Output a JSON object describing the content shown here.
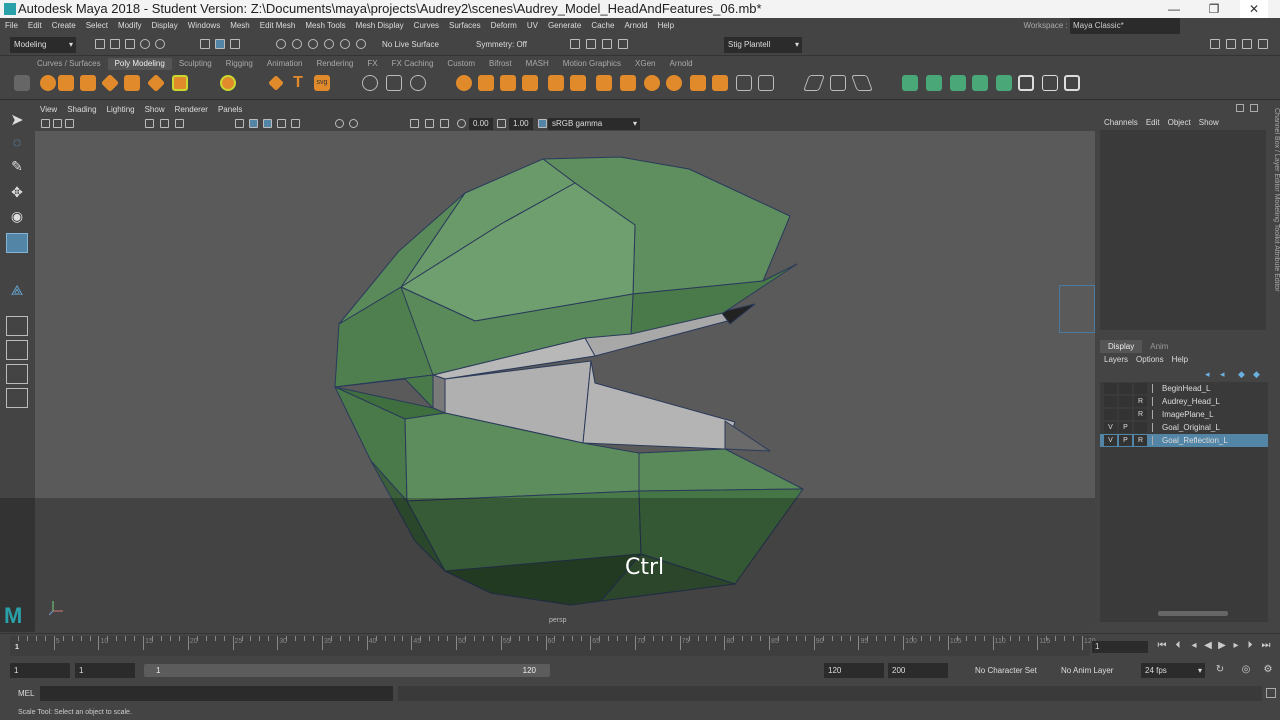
{
  "window": {
    "title": "Autodesk Maya 2018 - Student Version: Z:\\Documents\\maya\\projects\\Audrey2\\scenes\\Audrey_Model_HeadAndFeatures_06.mb*",
    "minimize": "—",
    "maximize": "❐",
    "close": "✕"
  },
  "menubar": {
    "items": [
      "File",
      "Edit",
      "Create",
      "Select",
      "Modify",
      "Display",
      "Windows",
      "Mesh",
      "Edit Mesh",
      "Mesh Tools",
      "Mesh Display",
      "Curves",
      "Surfaces",
      "Deform",
      "UV",
      "Generate",
      "Cache",
      "Arnold",
      "Help"
    ],
    "workspace_label": "Workspace :",
    "workspace_value": "Maya Classic*"
  },
  "statusline": {
    "menuset": "Modeling",
    "live_surface": "No Live Surface",
    "symmetry": "Symmetry: Off",
    "user": "Stig Plantell"
  },
  "shelf": {
    "tabs": [
      "Curves / Surfaces",
      "Poly Modeling",
      "Sculpting",
      "Rigging",
      "Animation",
      "Rendering",
      "FX",
      "FX Caching",
      "Custom",
      "Bifrost",
      "MASH",
      "Motion Graphics",
      "XGen",
      "Arnold"
    ],
    "active_tab": "Poly Modeling",
    "text_icon": "T",
    "svg_icon": "svg"
  },
  "panel": {
    "menus": [
      "View",
      "Shading",
      "Lighting",
      "Show",
      "Renderer",
      "Panels"
    ],
    "exposure": "0.00",
    "gamma": "1.00",
    "colorspace": "sRGB gamma",
    "camera": "persp",
    "key_hint": "Ctrl"
  },
  "channelbox": {
    "menus": [
      "Channels",
      "Edit",
      "Object",
      "Show"
    ],
    "side_tabs": "Channel Box / Layer Editor    Modeling Toolkit    Attribute Editor"
  },
  "layers": {
    "tabs": [
      "Display",
      "Anim"
    ],
    "active_tab": "Display",
    "menus": [
      "Layers",
      "Options",
      "Help"
    ],
    "rows": [
      {
        "v": "",
        "p": "",
        "r": "",
        "name": "BeginHead_L",
        "selected": false
      },
      {
        "v": "",
        "p": "",
        "r": "R",
        "name": "Audrey_Head_L",
        "selected": false
      },
      {
        "v": "",
        "p": "",
        "r": "R",
        "name": "ImagePlane_L",
        "selected": false
      },
      {
        "v": "V",
        "p": "P",
        "r": "",
        "name": "Goal_Original_L",
        "selected": false
      },
      {
        "v": "V",
        "p": "P",
        "r": "R",
        "name": "Goal_Reflection_L",
        "selected": true
      }
    ]
  },
  "timeline": {
    "start_marker": "1",
    "ticks": [
      "5",
      "10",
      "15",
      "20",
      "25",
      "30",
      "35",
      "40",
      "45",
      "50",
      "55",
      "60",
      "65",
      "70",
      "75",
      "80",
      "85",
      "90",
      "95",
      "100",
      "105",
      "110",
      "115",
      "120"
    ],
    "current_frame": "1"
  },
  "range": {
    "start": "1",
    "playback_start": "1",
    "slider_start": "1",
    "slider_end": "120",
    "playback_end": "120",
    "end": "200",
    "character_set": "No Character Set",
    "anim_layer": "No Anim Layer",
    "fps": "24 fps"
  },
  "commandline": {
    "language": "MEL"
  },
  "helpline": {
    "text": "Scale Tool: Select an object to scale."
  },
  "colors": {
    "mesh_green": "#5a8a5a",
    "selection_blue": "#5285a6",
    "panel_gray": "#444444",
    "viewport_gray": "#5a5a5a"
  }
}
